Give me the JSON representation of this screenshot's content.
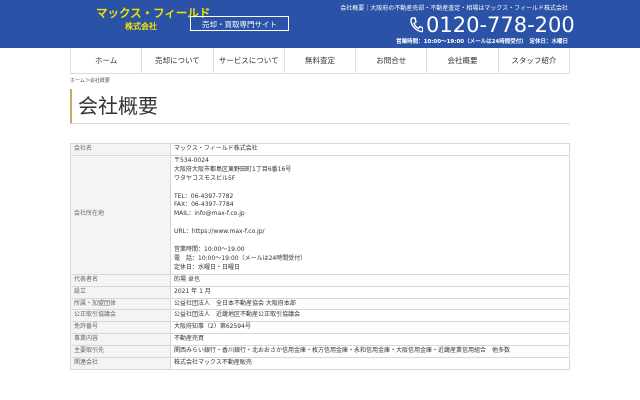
{
  "header": {
    "logo_main": "マックス・フィールド",
    "logo_sub": "株式会社",
    "badge": "売却・買取専門サイト",
    "tagline": "会社概要｜大阪府の不動産売却・不動産査定・相場はマックス・フィールド株式会社",
    "phone": "0120-778-200",
    "hours": "営業時間：10:00〜19:00（メールは24時間受付）　定休日：水曜日"
  },
  "nav": [
    "ホーム",
    "売却について",
    "サービスについて",
    "無料査定",
    "お問合せ",
    "会社概要",
    "スタッフ紹介"
  ],
  "breadcrumb": "ホーム＞会社概要",
  "page_title": "会社概要",
  "company_table": [
    {
      "label": "会社名",
      "value": "マックス・フィールド株式会社"
    },
    {
      "label": "会社所在地",
      "value": "〒534-0024\n大阪府大阪市都島区東野田町1丁目6番16号\nワタヤコスモスビル5F\n\nTEL：06-4397-7782\nFAX：06-4397-7784\nMAIL：info@max-f.co.jp\n\nURL：https://www.max-f.co.jp/\n\n営業時間：10:00〜19:00\n電　話：10:00〜19:00（メールは24時間受付）\n定休日：水曜日・日曜日"
    },
    {
      "label": "代表者名",
      "value": "的場 卓也"
    },
    {
      "label": "設立",
      "value": "2021 年 1 月"
    },
    {
      "label": "所属・加盟団体",
      "value": "公益社団法人　全日本不動産協会 大阪府本部"
    },
    {
      "label": "公正取引協議会",
      "value": "公益社団法人　近畿地区不動産公正取引協議会"
    },
    {
      "label": "免許番号",
      "value": "大阪府知事（2）第62594号"
    },
    {
      "label": "事業内容",
      "value": "不動産売買"
    },
    {
      "label": "主要取引先",
      "value": "関西みらい銀行・香川銀行・北おおさか信用金庫・枚方信用金庫・永和信用金庫・大阪信用金庫・近畿産業信用組合　他多数"
    },
    {
      "label": "関連会社",
      "value": "株式会社マックス不動産販売"
    }
  ]
}
